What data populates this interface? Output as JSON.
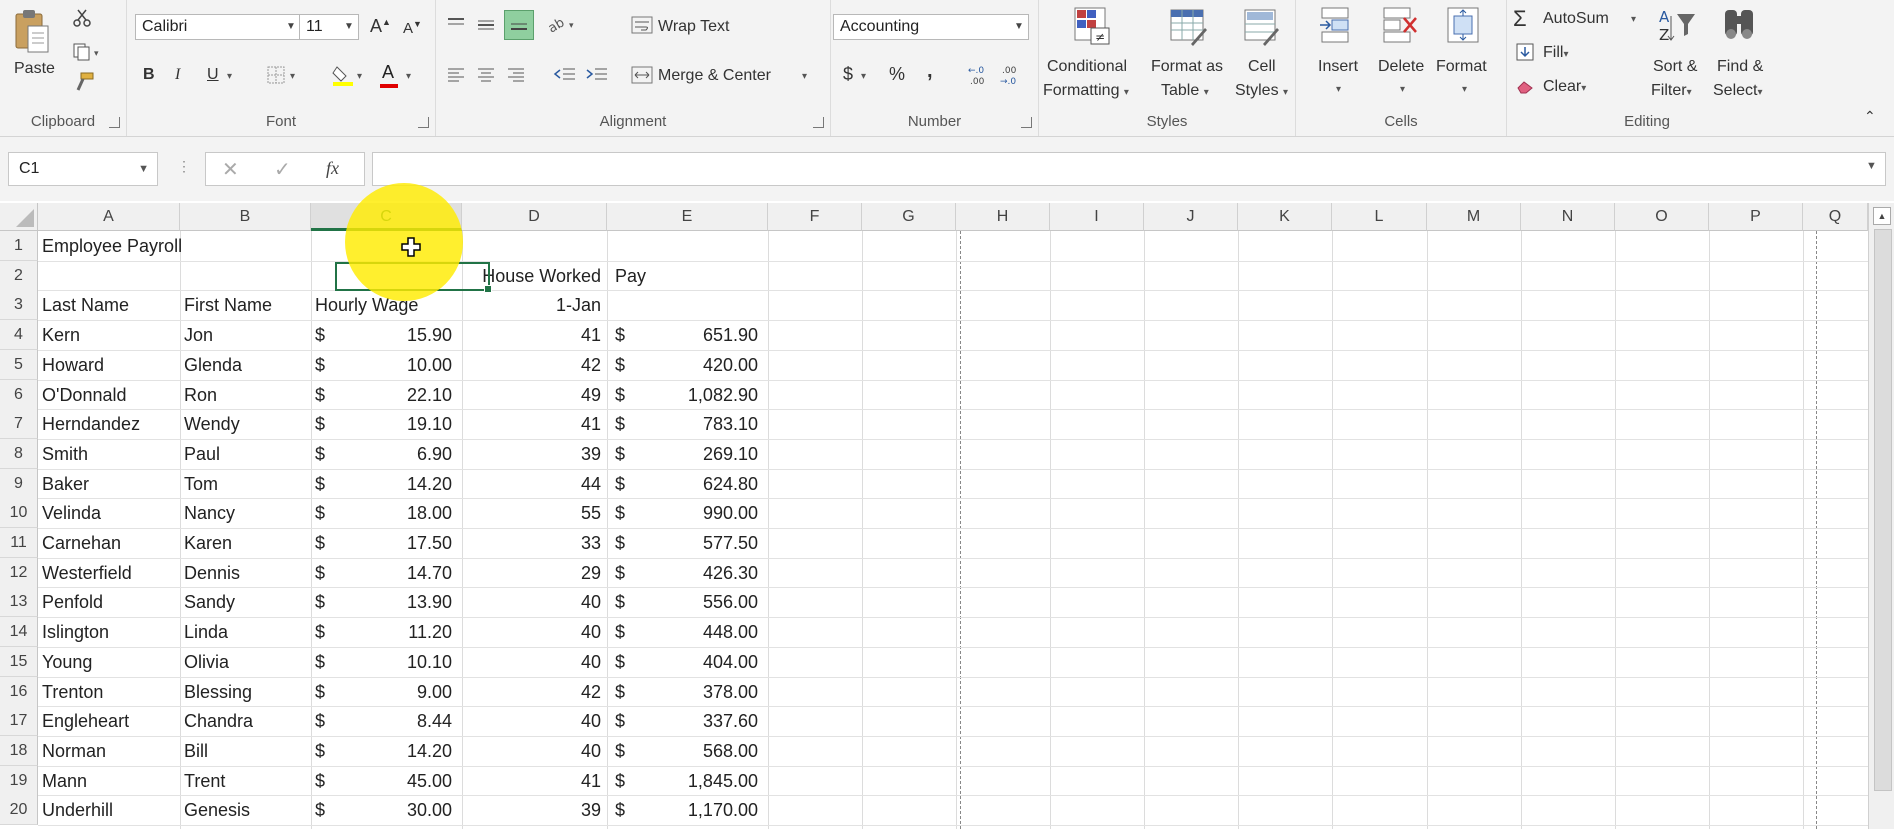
{
  "ribbon": {
    "clipboard": {
      "paste_label": "Paste",
      "group_label": "Clipboard"
    },
    "font": {
      "font_name": "Calibri",
      "font_size": "11",
      "grow_label": "A",
      "shrink_label": "A",
      "bold": "B",
      "italic": "I",
      "underline": "U",
      "color_letter": "A",
      "group_label": "Font"
    },
    "alignment": {
      "wrap_text_label": "Wrap Text",
      "merge_center_label": "Merge & Center",
      "group_label": "Alignment"
    },
    "number": {
      "format": "Accounting",
      "currency": "$",
      "percent": "%",
      "comma": ",",
      "inc_decimal": "+.0\n.00",
      "dec_decimal": ".00\n→.0",
      "group_label": "Number"
    },
    "styles": {
      "conditional_formatting_l1": "Conditional",
      "conditional_formatting_l2": "Formatting",
      "format_table_l1": "Format as",
      "format_table_l2": "Table",
      "cell_styles_l1": "Cell",
      "cell_styles_l2": "Styles",
      "group_label": "Styles"
    },
    "cells": {
      "insert_label": "Insert",
      "delete_label": "Delete",
      "format_label": "Format",
      "group_label": "Cells"
    },
    "editing": {
      "autosum_label": "AutoSum",
      "fill_label": "Fill",
      "clear_label": "Clear",
      "sort_filter_l1": "Sort &",
      "sort_filter_l2": "Filter",
      "find_select_l1": "Find &",
      "find_select_l2": "Select",
      "group_label": "Editing"
    }
  },
  "formula_bar": {
    "name_box": "C1",
    "fx": "fx",
    "formula": ""
  },
  "columns": [
    "A",
    "B",
    "C",
    "D",
    "E",
    "F",
    "G",
    "H",
    "I",
    "J",
    "K",
    "L",
    "M",
    "N",
    "O",
    "P",
    "Q"
  ],
  "selected_column": "C",
  "rows": [
    {
      "n": "1",
      "a": "Employee Payroll",
      "b": "",
      "c_cur": "",
      "c": "",
      "d": "",
      "e_cur": "",
      "e": ""
    },
    {
      "n": "2",
      "a": "",
      "b": "",
      "c_cur": "",
      "c": "",
      "d": "House Worked",
      "e_cur": "Pay",
      "e": ""
    },
    {
      "n": "3",
      "a": "Last Name",
      "b": "First Name",
      "c_cur": "Hourly Wage",
      "c": "",
      "d": "1-Jan",
      "e_cur": "",
      "e": ""
    },
    {
      "n": "4",
      "a": "Kern",
      "b": "Jon",
      "c_cur": "$",
      "c": "15.90",
      "d": "41",
      "e_cur": "$",
      "e": "651.90"
    },
    {
      "n": "5",
      "a": "Howard",
      "b": "Glenda",
      "c_cur": "$",
      "c": "10.00",
      "d": "42",
      "e_cur": "$",
      "e": "420.00"
    },
    {
      "n": "6",
      "a": "O'Donnald",
      "b": "Ron",
      "c_cur": "$",
      "c": "22.10",
      "d": "49",
      "e_cur": "$",
      "e": "1,082.90"
    },
    {
      "n": "7",
      "a": "Herndandez",
      "b": "Wendy",
      "c_cur": "$",
      "c": "19.10",
      "d": "41",
      "e_cur": "$",
      "e": "783.10"
    },
    {
      "n": "8",
      "a": "Smith",
      "b": "Paul",
      "c_cur": "$",
      "c": "6.90",
      "d": "39",
      "e_cur": "$",
      "e": "269.10"
    },
    {
      "n": "9",
      "a": "Baker",
      "b": "Tom",
      "c_cur": "$",
      "c": "14.20",
      "d": "44",
      "e_cur": "$",
      "e": "624.80"
    },
    {
      "n": "10",
      "a": "Velinda",
      "b": "Nancy",
      "c_cur": "$",
      "c": "18.00",
      "d": "55",
      "e_cur": "$",
      "e": "990.00"
    },
    {
      "n": "11",
      "a": "Carnehan",
      "b": "Karen",
      "c_cur": "$",
      "c": "17.50",
      "d": "33",
      "e_cur": "$",
      "e": "577.50"
    },
    {
      "n": "12",
      "a": "Westerfield",
      "b": "Dennis",
      "c_cur": "$",
      "c": "14.70",
      "d": "29",
      "e_cur": "$",
      "e": "426.30"
    },
    {
      "n": "13",
      "a": "Penfold",
      "b": "Sandy",
      "c_cur": "$",
      "c": "13.90",
      "d": "40",
      "e_cur": "$",
      "e": "556.00"
    },
    {
      "n": "14",
      "a": "Islington",
      "b": "Linda",
      "c_cur": "$",
      "c": "11.20",
      "d": "40",
      "e_cur": "$",
      "e": "448.00"
    },
    {
      "n": "15",
      "a": "Young",
      "b": "Olivia",
      "c_cur": "$",
      "c": "10.10",
      "d": "40",
      "e_cur": "$",
      "e": "404.00"
    },
    {
      "n": "16",
      "a": "Trenton",
      "b": "Blessing",
      "c_cur": "$",
      "c": "9.00",
      "d": "42",
      "e_cur": "$",
      "e": "378.00"
    },
    {
      "n": "17",
      "a": "Engleheart",
      "b": "Chandra",
      "c_cur": "$",
      "c": "8.44",
      "d": "40",
      "e_cur": "$",
      "e": "337.60"
    },
    {
      "n": "18",
      "a": "Norman",
      "b": "Bill",
      "c_cur": "$",
      "c": "14.20",
      "d": "40",
      "e_cur": "$",
      "e": "568.00"
    },
    {
      "n": "19",
      "a": "Mann",
      "b": "Trent",
      "c_cur": "$",
      "c": "45.00",
      "d": "41",
      "e_cur": "$",
      "e": "1,845.00"
    },
    {
      "n": "20",
      "a": "Underhill",
      "b": "Genesis",
      "c_cur": "$",
      "c": "30.00",
      "d": "39",
      "e_cur": "$",
      "e": "1,170.00"
    }
  ],
  "colors": {
    "accent": "#217346",
    "highlight": "#ffec00",
    "font_color_bar": "#e00000",
    "fill_color_bar": "#ffff00"
  }
}
